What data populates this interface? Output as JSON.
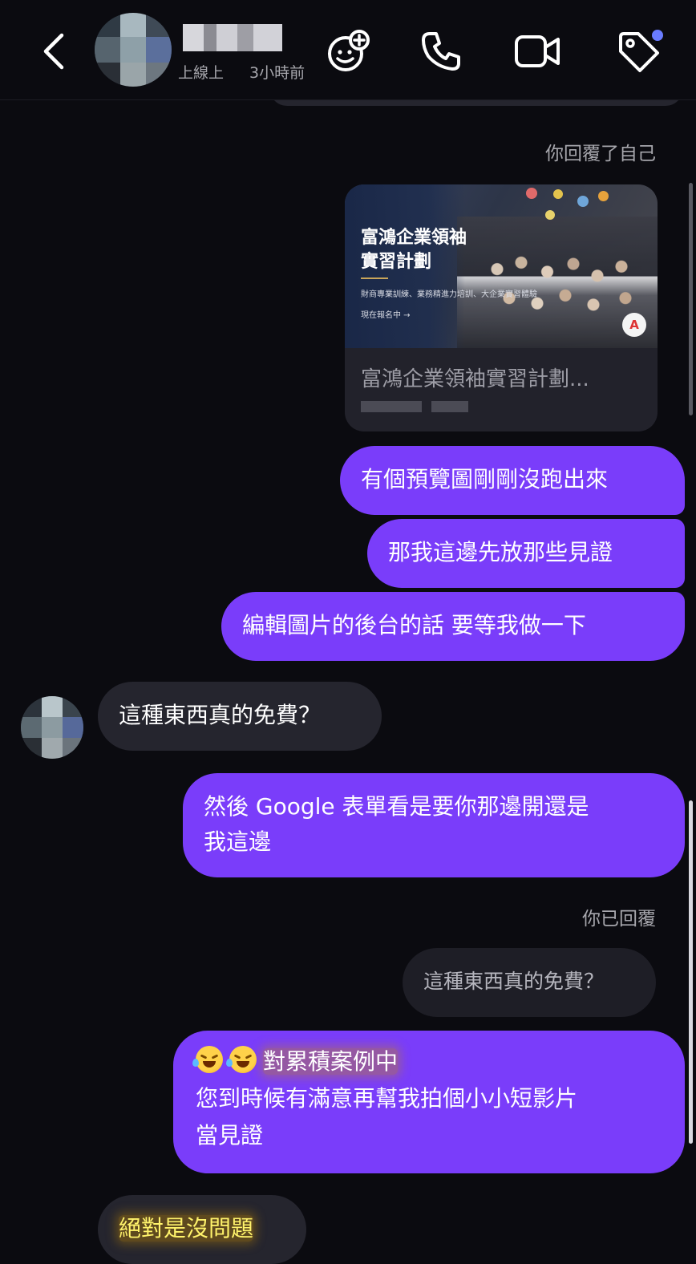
{
  "header": {
    "status_online": "上線上",
    "status_time": "3小時前",
    "icons": [
      "back-chevron-icon",
      "add-game-icon",
      "phone-icon",
      "video-camera-icon",
      "tag-icon"
    ],
    "tag_dot_color": "#6a7cff"
  },
  "thread": {
    "reply_note_self": "你回覆了自己",
    "link_preview": {
      "image_title_line1": "富鴻企業領袖",
      "image_title_line2": "實習計劃",
      "image_subtitle": "財商專業訓練、業務精進力培訓、大企業實習體驗",
      "image_cta": "現在報名中 →",
      "title": "富鴻企業領袖實習計劃..."
    },
    "messages": [
      {
        "side": "out",
        "text": "有個預覽圖剛剛沒跑出來"
      },
      {
        "side": "out",
        "text": "那我這邊先放那些見證"
      },
      {
        "side": "out",
        "text": "編輯圖片的後台的話 要等我做一下"
      },
      {
        "side": "in",
        "text": "這種東西真的免費？"
      },
      {
        "side": "out",
        "line1": "然後 Google 表單看是要你那邊開還是",
        "line2": "我這邊"
      }
    ],
    "reply_note_replied": "你已回覆",
    "quoted_message": "這種東西真的免費？",
    "reply_message": {
      "highlight": "對累積案例中",
      "line2": "您到時候有滿意再幫我拍個小小短影片",
      "line3": "當見證"
    },
    "last_incoming": "絕對是沒問題"
  },
  "colors": {
    "outgoing_bubble": "#7a3dfa",
    "incoming_bubble": "#25252e",
    "background": "#0b0b10"
  }
}
